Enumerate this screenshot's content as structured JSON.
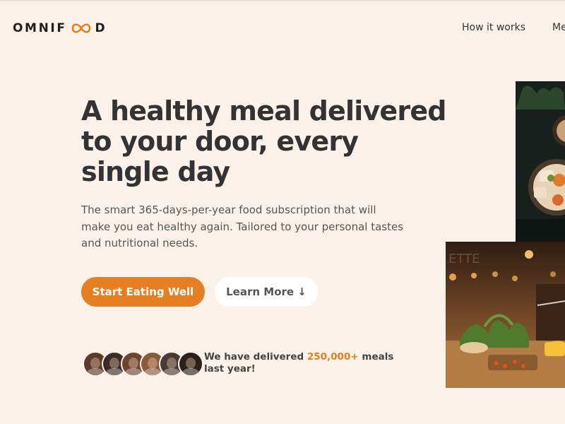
{
  "brand": {
    "logo_left": "OMNIF",
    "logo_right": "D",
    "accent": "#e67e22",
    "background": "#fdf2e9"
  },
  "nav": {
    "items": [
      {
        "label": "How it works"
      },
      {
        "label": "Mea"
      }
    ]
  },
  "hero": {
    "title": "A healthy meal delivered to your door, every single day",
    "description": "The smart 365-days-per-year food subscription that will make you eat healthy again. Tailored to your personal tastes and nutritional needs.",
    "primary_button": "Start Eating Well",
    "secondary_button": "Learn More ↓",
    "delivered": {
      "prefix": "We have delivered ",
      "highlight": "250,000+",
      "suffix": " meals last year!"
    },
    "avatars": [
      {
        "icon": "customer-avatar-1",
        "color": "#5b3a2a"
      },
      {
        "icon": "customer-avatar-2",
        "color": "#3c2b26"
      },
      {
        "icon": "customer-avatar-3",
        "color": "#6d4430"
      },
      {
        "icon": "customer-avatar-4",
        "color": "#8a5a3c"
      },
      {
        "icon": "customer-avatar-5",
        "color": "#4a3a33"
      },
      {
        "icon": "customer-avatar-6",
        "color": "#2e1f1a"
      }
    ]
  },
  "images": [
    {
      "icon": "food-bowl-photo"
    },
    {
      "icon": "dining-table-photo"
    }
  ]
}
